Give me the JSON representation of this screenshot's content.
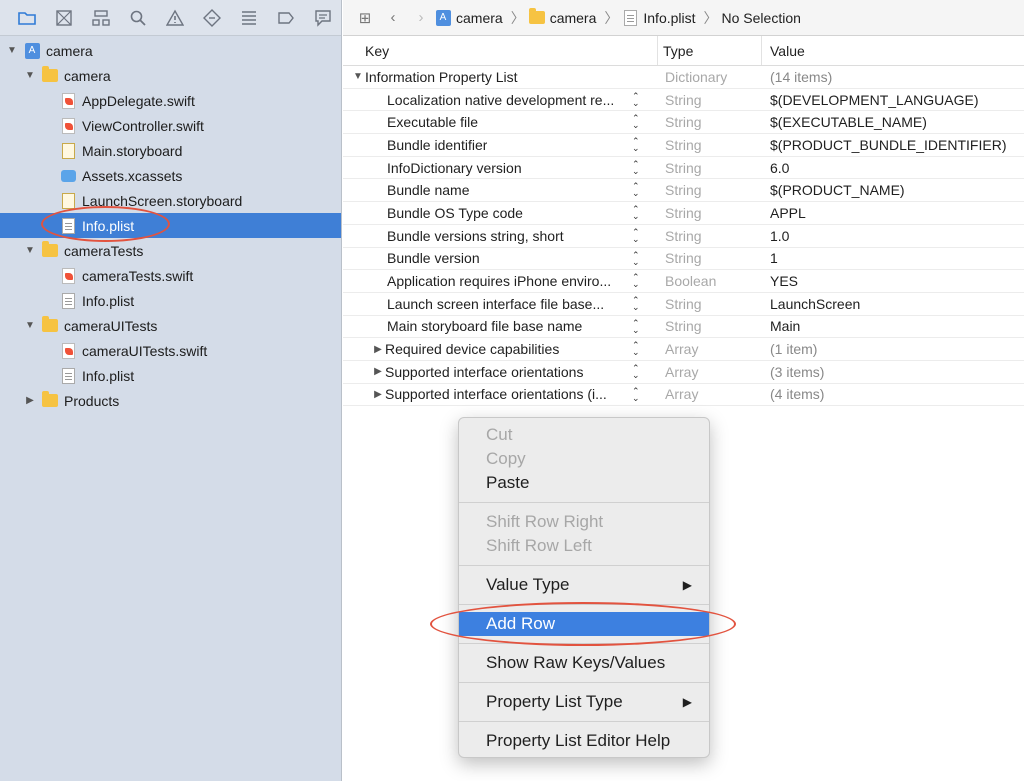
{
  "navigator": {
    "toolbar_icons": [
      "folder-icon",
      "source-control-icon",
      "hierarchy-icon",
      "search-icon",
      "warning-icon",
      "test-icon",
      "debug-icon",
      "breakpoint-icon",
      "report-icon"
    ],
    "tree": [
      {
        "label": "camera",
        "icon": "project",
        "level": 0,
        "disclosure": "open"
      },
      {
        "label": "camera",
        "icon": "folder",
        "level": 1,
        "disclosure": "open"
      },
      {
        "label": "AppDelegate.swift",
        "icon": "swift",
        "level": 2
      },
      {
        "label": "ViewController.swift",
        "icon": "swift",
        "level": 2
      },
      {
        "label": "Main.storyboard",
        "icon": "storyboard",
        "level": 2
      },
      {
        "label": "Assets.xcassets",
        "icon": "assets",
        "level": 2
      },
      {
        "label": "LaunchScreen.storyboard",
        "icon": "storyboard",
        "level": 2
      },
      {
        "label": "Info.plist",
        "icon": "plist",
        "level": 2,
        "selected": true
      },
      {
        "label": "cameraTests",
        "icon": "folder",
        "level": 1,
        "disclosure": "open"
      },
      {
        "label": "cameraTests.swift",
        "icon": "swift",
        "level": 2
      },
      {
        "label": "Info.plist",
        "icon": "plist",
        "level": 2
      },
      {
        "label": "cameraUITests",
        "icon": "folder",
        "level": 1,
        "disclosure": "open"
      },
      {
        "label": "cameraUITests.swift",
        "icon": "swift",
        "level": 2
      },
      {
        "label": "Info.plist",
        "icon": "plist",
        "level": 2
      },
      {
        "label": "Products",
        "icon": "folder",
        "level": 1,
        "disclosure": "closed"
      }
    ]
  },
  "jumpbar": {
    "crumbs": [
      "camera",
      "camera",
      "Info.plist",
      "No Selection"
    ]
  },
  "plist": {
    "columns": {
      "key": "Key",
      "type": "Type",
      "value": "Value"
    },
    "root": {
      "key": "Information Property List",
      "type": "Dictionary",
      "value": "(14 items)"
    },
    "rows": [
      {
        "key": "Localization native development re...",
        "type": "String",
        "value": "$(DEVELOPMENT_LANGUAGE)"
      },
      {
        "key": "Executable file",
        "type": "String",
        "value": "$(EXECUTABLE_NAME)"
      },
      {
        "key": "Bundle identifier",
        "type": "String",
        "value": "$(PRODUCT_BUNDLE_IDENTIFIER)"
      },
      {
        "key": "InfoDictionary version",
        "type": "String",
        "value": "6.0"
      },
      {
        "key": "Bundle name",
        "type": "String",
        "value": "$(PRODUCT_NAME)"
      },
      {
        "key": "Bundle OS Type code",
        "type": "String",
        "value": "APPL"
      },
      {
        "key": "Bundle versions string, short",
        "type": "String",
        "value": "1.0"
      },
      {
        "key": "Bundle version",
        "type": "String",
        "value": "1"
      },
      {
        "key": "Application requires iPhone enviro...",
        "type": "Boolean",
        "value": "YES"
      },
      {
        "key": "Launch screen interface file base...",
        "type": "String",
        "value": "LaunchScreen"
      },
      {
        "key": "Main storyboard file base name",
        "type": "String",
        "value": "Main"
      },
      {
        "key": "Required device capabilities",
        "type": "Array",
        "value": "(1 item)",
        "expandable": true
      },
      {
        "key": "Supported interface orientations",
        "type": "Array",
        "value": "(3 items)",
        "expandable": true
      },
      {
        "key": "Supported interface orientations (i...",
        "type": "Array",
        "value": "(4 items)",
        "expandable": true
      }
    ]
  },
  "context_menu": {
    "groups": [
      [
        {
          "label": "Cut",
          "enabled": false
        },
        {
          "label": "Copy",
          "enabled": false
        },
        {
          "label": "Paste",
          "enabled": true
        }
      ],
      [
        {
          "label": "Shift Row Right",
          "enabled": false
        },
        {
          "label": "Shift Row Left",
          "enabled": false
        }
      ],
      [
        {
          "label": "Value Type",
          "enabled": true,
          "submenu": true
        }
      ],
      [
        {
          "label": "Add Row",
          "enabled": true,
          "highlighted": true
        }
      ],
      [
        {
          "label": "Show Raw Keys/Values",
          "enabled": true
        }
      ],
      [
        {
          "label": "Property List Type",
          "enabled": true,
          "submenu": true
        }
      ],
      [
        {
          "label": "Property List Editor Help",
          "enabled": true
        }
      ]
    ]
  },
  "colors": {
    "sidebar_bg": "#d4dce8",
    "selection": "#3f7fd6",
    "menu_highlight": "#3d80e0",
    "annotation": "#e2533f"
  }
}
